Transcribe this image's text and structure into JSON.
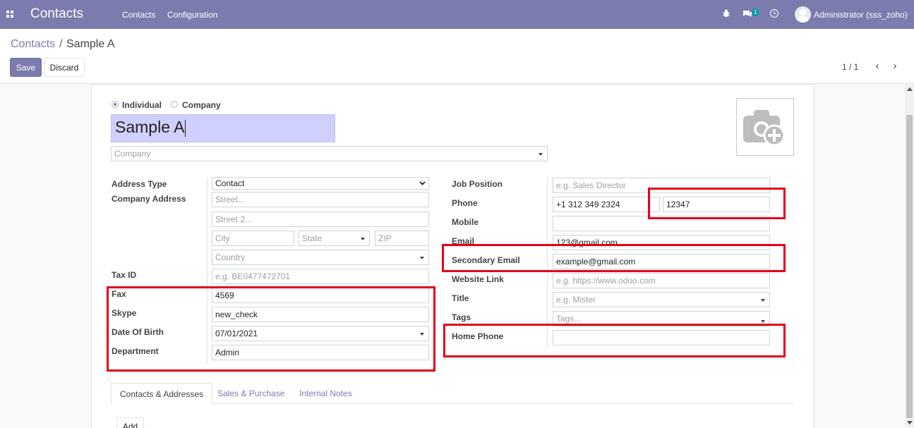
{
  "navbar": {
    "brand": "Contacts",
    "menu": [
      "Contacts",
      "Configuration"
    ],
    "message_count": "1",
    "user": "Administrator (sss_zoho)",
    "icons": [
      "apps-icon",
      "bug-icon",
      "chat-icon",
      "clock-icon"
    ]
  },
  "breadcrumb": {
    "parent": "Contacts",
    "separator": "/",
    "current": "Sample A"
  },
  "buttons": {
    "save": "Save",
    "discard": "Discard",
    "add": "Add"
  },
  "pager": {
    "value": "1 / 1"
  },
  "form": {
    "type_options": {
      "individual": "Individual",
      "company": "Company",
      "selected": "Individual"
    },
    "name": "Sample A",
    "company_placeholder": "Company",
    "left": {
      "address_type_label": "Address Type",
      "address_type_value": "Contact",
      "company_address_label": "Company Address",
      "street_ph": "Street...",
      "street2_ph": "Street 2...",
      "city_ph": "City",
      "state_ph": "State",
      "zip_ph": "ZIP",
      "country_ph": "Country",
      "tax_id_label": "Tax ID",
      "tax_id_ph": "e.g. BE0477472701",
      "fax_label": "Fax",
      "fax_value": "4569",
      "skype_label": "Skype",
      "skype_value": "new_check",
      "dob_label": "Date Of Birth",
      "dob_value": "07/01/2021",
      "department_label": "Department",
      "department_value": "Admin"
    },
    "right": {
      "job_label": "Job Position",
      "job_ph": "e.g. Sales Director",
      "phone_label": "Phone",
      "phone_value": "+1 312 349 2324",
      "phone_ext_value": "12347",
      "mobile_label": "Mobile",
      "email_label": "Email",
      "email_value": "123@gmail.com",
      "secondary_email_label": "Secondary Email",
      "secondary_email_value": "example@gmail.com",
      "website_label": "Website Link",
      "website_ph": "e.g. https://www.odoo.com",
      "title_label": "Title",
      "title_ph": "e.g. Mister",
      "tags_label": "Tags",
      "tags_ph": "Tags...",
      "home_phone_label": "Home Phone"
    }
  },
  "tabs": [
    "Contacts & Addresses",
    "Sales & Purchase",
    "Internal Notes"
  ],
  "colors": {
    "brand": "#7c7bad",
    "highlight": "#e3001b",
    "name_bg": "#cfd0fb"
  }
}
